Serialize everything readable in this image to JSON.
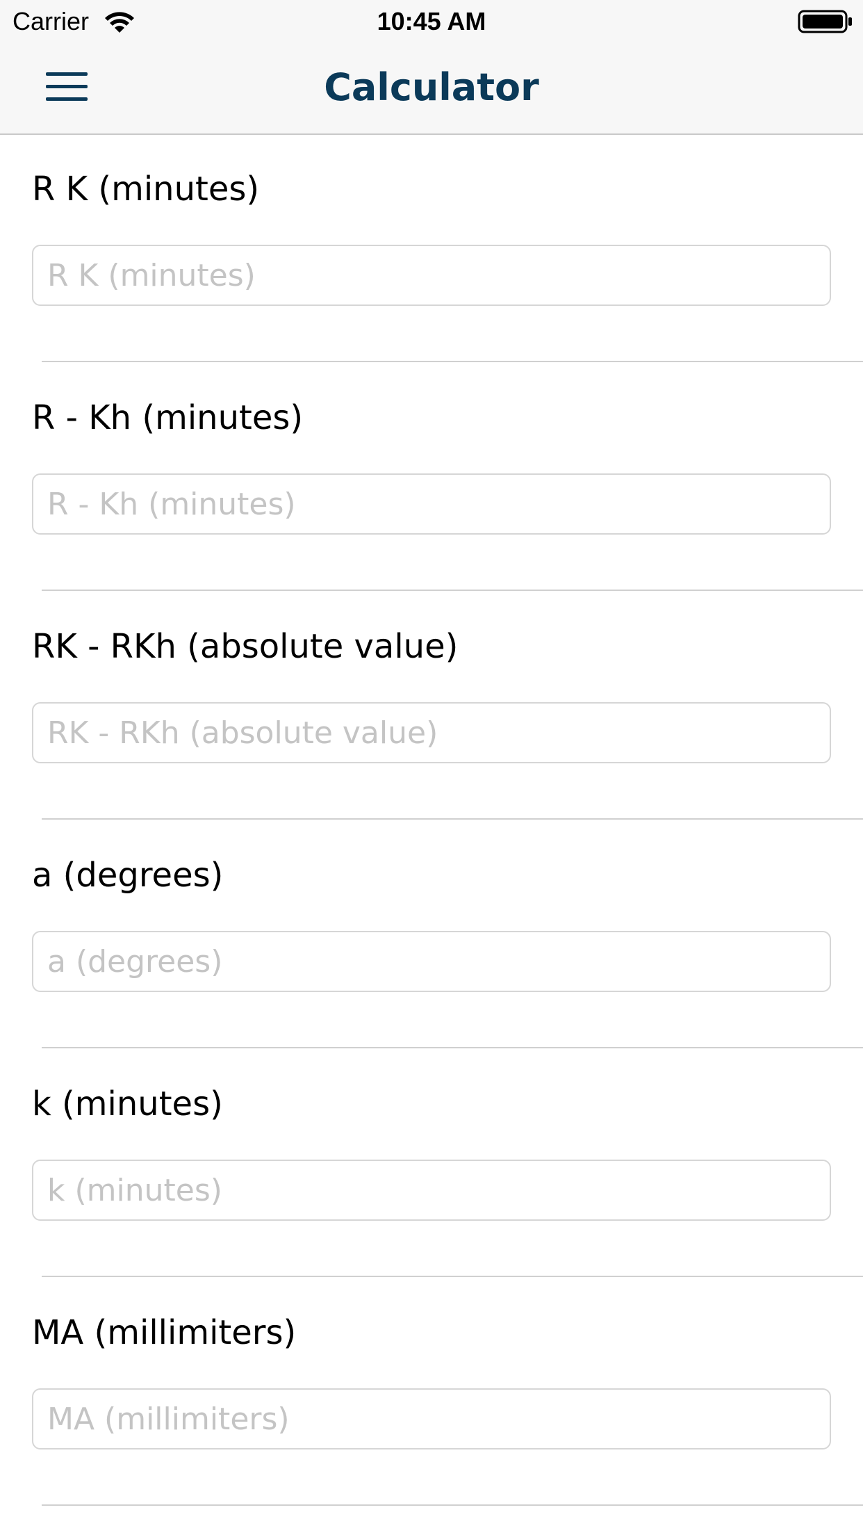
{
  "status_bar": {
    "carrier": "Carrier",
    "time": "10:45 AM",
    "wifi_icon": "wifi-icon",
    "battery_icon": "battery-full-icon"
  },
  "nav": {
    "title": "Calculator",
    "menu_icon": "hamburger-menu-icon",
    "title_color": "#0b3a59"
  },
  "form": {
    "fields": [
      {
        "label": "R K (minutes)",
        "placeholder": "R K (minutes)",
        "value": ""
      },
      {
        "label": "R - Kh (minutes)",
        "placeholder": "R - Kh (minutes)",
        "value": ""
      },
      {
        "label": "RK - RKh (absolute value)",
        "placeholder": "RK - RKh (absolute value)",
        "value": ""
      },
      {
        "label": "a (degrees)",
        "placeholder": "a (degrees)",
        "value": ""
      },
      {
        "label": "k (minutes)",
        "placeholder": "k (minutes)",
        "value": ""
      },
      {
        "label": "MA (millimiters)",
        "placeholder": "MA (millimiters)",
        "value": ""
      }
    ]
  }
}
